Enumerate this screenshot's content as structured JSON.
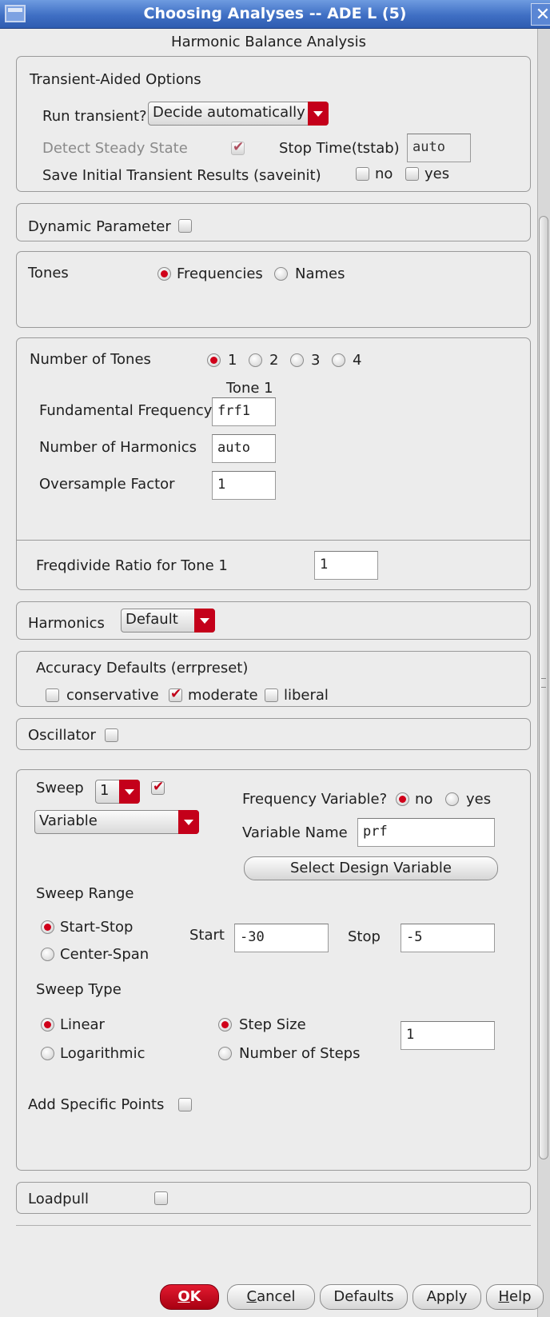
{
  "window": {
    "title": "Choosing Analyses -- ADE L (5)",
    "close_glyph": "✕"
  },
  "analysis": {
    "title": "Harmonic Balance Analysis"
  },
  "transient": {
    "heading": "Transient-Aided Options",
    "run_label": "Run transient?",
    "run_value": "Decide automatically",
    "detect_label": "Detect Steady State",
    "stop_label": "Stop Time(tstab)",
    "stop_value": "auto",
    "save_label": "Save Initial Transient Results (saveinit)",
    "no_label": "no",
    "yes_label": "yes"
  },
  "dynamic": {
    "label": "Dynamic Parameter"
  },
  "tones": {
    "label": "Tones",
    "frequencies_label": "Frequencies",
    "names_label": "Names"
  },
  "numtones": {
    "label": "Number of Tones",
    "options": [
      "1",
      "2",
      "3",
      "4"
    ],
    "column_header": "Tone 1",
    "fund_label": "Fundamental Frequency",
    "fund_value": "frf1",
    "harm_label": "Number of Harmonics",
    "harm_value": "auto",
    "oversample_label": "Oversample Factor",
    "oversample_value": "1",
    "freqdivide_label": "Freqdivide Ratio for Tone 1",
    "freqdivide_value": "1"
  },
  "harmonics": {
    "label": "Harmonics",
    "value": "Default"
  },
  "accuracy": {
    "heading": "Accuracy Defaults (errpreset)",
    "conservative": "conservative",
    "moderate": "moderate",
    "liberal": "liberal"
  },
  "oscillator": {
    "label": "Oscillator"
  },
  "sweep": {
    "label": "Sweep",
    "count_value": "1",
    "kind_value": "Variable",
    "freqvar_label": "Frequency Variable?",
    "no_label": "no",
    "yes_label": "yes",
    "varname_label": "Variable Name",
    "varname_value": "prf",
    "select_button": "Select Design Variable",
    "range_heading": "Sweep Range",
    "startstop_label": "Start-Stop",
    "centerspan_label": "Center-Span",
    "start_label": "Start",
    "start_value": "-30",
    "stop_label": "Stop",
    "stop_value": "-5",
    "type_heading": "Sweep Type",
    "linear_label": "Linear",
    "log_label": "Logarithmic",
    "stepsize_label": "Step Size",
    "numsteps_label": "Number of Steps",
    "step_value": "1",
    "specific_label": "Add Specific Points"
  },
  "loadpull": {
    "label": "Loadpull"
  },
  "buttons": {
    "ok_hotkey": "O",
    "ok_rest": "K",
    "cancel_hotkey": "C",
    "cancel_rest": "ancel",
    "defaults": "Defaults",
    "apply": "Apply",
    "help_hotkey": "H",
    "help_rest": "elp"
  },
  "colors": {
    "accent": "#c4001a",
    "titlebar": "#3f6fc4",
    "panel_bg": "#ececec"
  }
}
